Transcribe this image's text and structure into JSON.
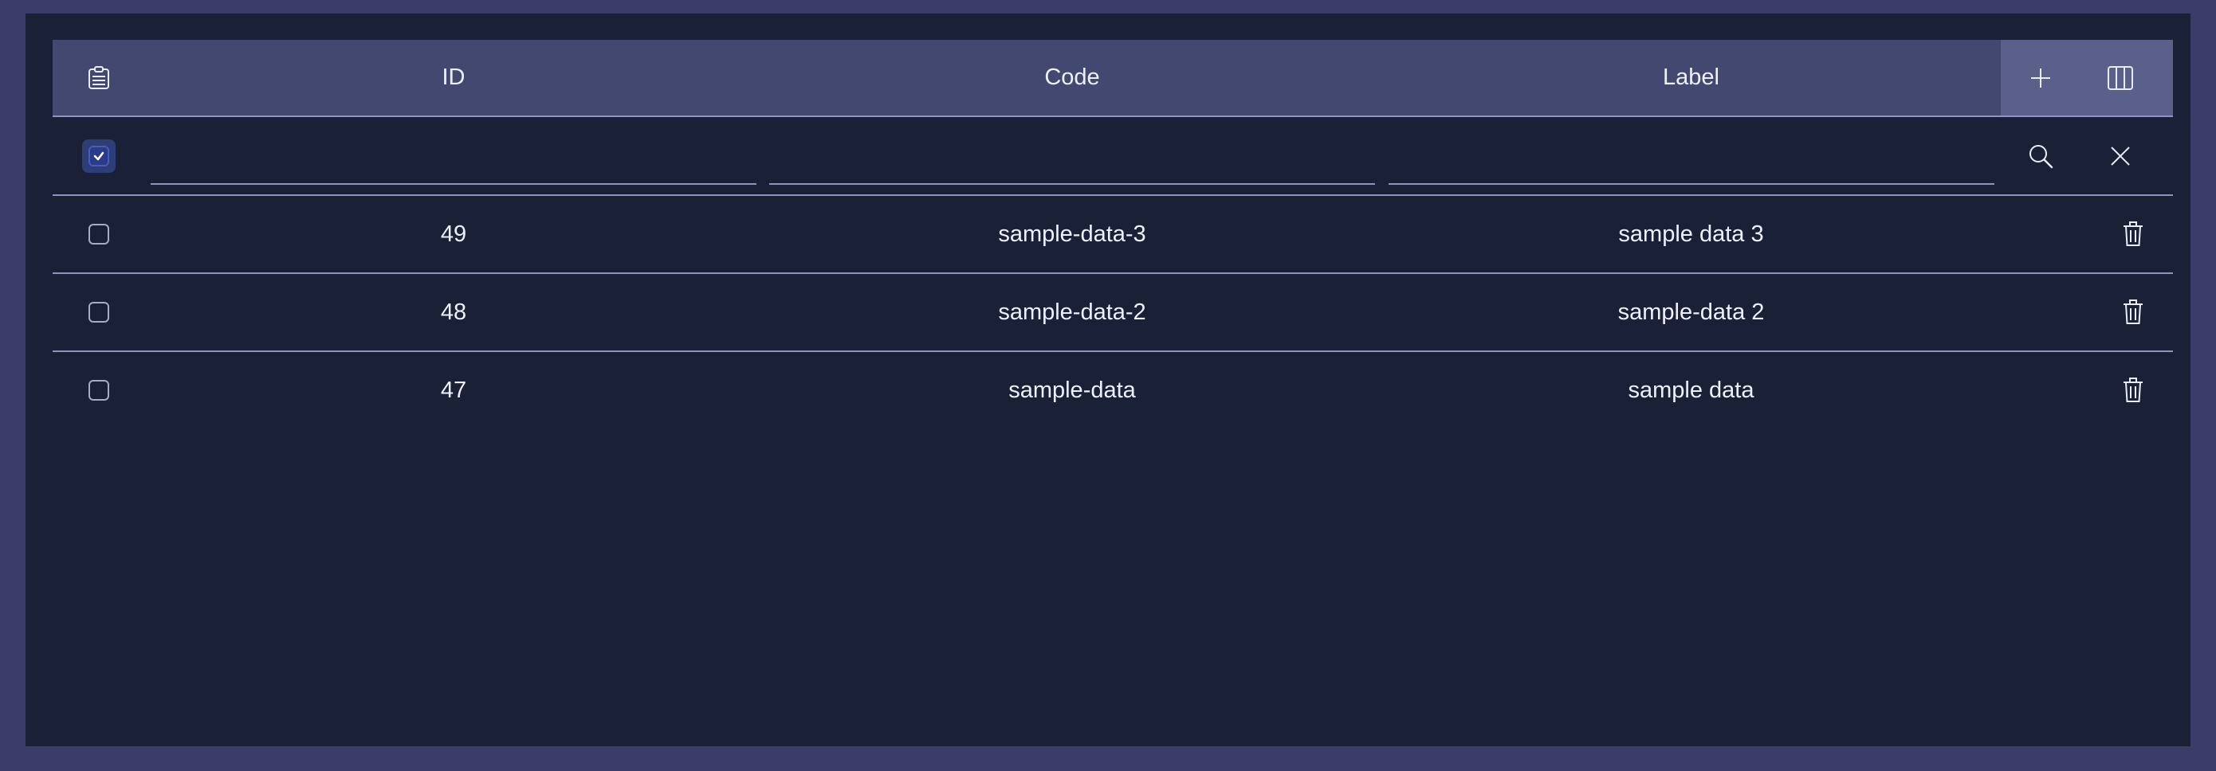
{
  "header": {
    "columns": {
      "id": "ID",
      "code": "Code",
      "label": "Label"
    },
    "icons": {
      "select_menu": "clipboard-list-icon",
      "add": "plus-icon",
      "columns": "columns-icon"
    }
  },
  "filter": {
    "select_all_checked": true,
    "id_value": "",
    "code_value": "",
    "label_value": "",
    "icons": {
      "search": "search-icon",
      "clear": "close-icon"
    }
  },
  "rows": [
    {
      "id": "49",
      "code": "sample-data-3",
      "label": "sample data 3",
      "checked": false
    },
    {
      "id": "48",
      "code": "sample-data-2",
      "label": "sample-data 2",
      "checked": false
    },
    {
      "id": "47",
      "code": "sample-data",
      "label": "sample data",
      "checked": false
    }
  ],
  "colors": {
    "page_bg": "#3b3c67",
    "panel_bg": "#1a2035",
    "header_bg": "#434871",
    "header_actions_bg": "#5a6089",
    "divider": "#8f94bf",
    "text": "#eef0fb"
  }
}
